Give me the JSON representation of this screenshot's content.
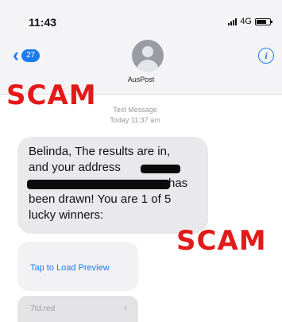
{
  "status_bar": {
    "time": "11:43",
    "network": "4G"
  },
  "header": {
    "back_badge": "27",
    "contact_name": "AusPost",
    "info_icon": "i"
  },
  "overlays": {
    "scam_top": "SCAM",
    "scam_bottom": "SCAM",
    "color": "#e31a1a"
  },
  "conversation": {
    "meta_line1": "Text Message",
    "meta_line2": "Today 11:37 am",
    "message": {
      "line1": "Belinda, The results are in,",
      "line2": "and your address",
      "line3": "has",
      "line4": "been drawn! You are 1 of 5",
      "line5": "lucky winners:"
    },
    "link_preview": {
      "label": "Tap to Load Preview"
    },
    "link_preview_2": {
      "label": "7td.red"
    }
  },
  "accent_color": "#1a7cf0"
}
